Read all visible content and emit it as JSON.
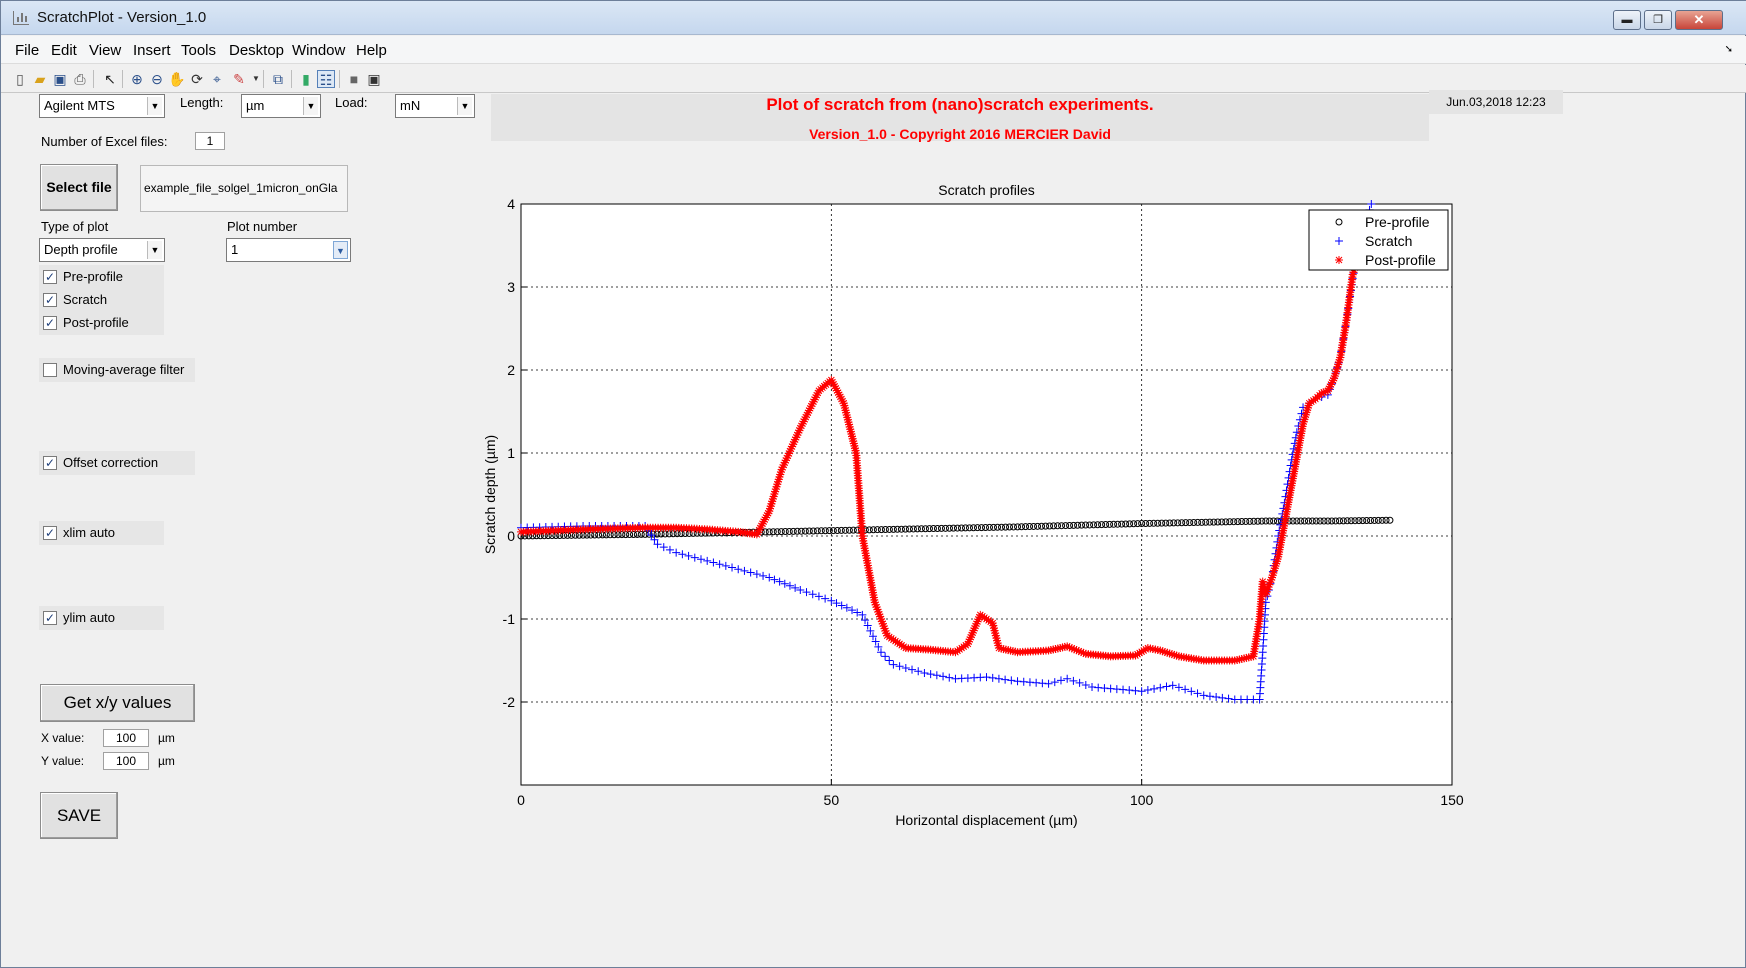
{
  "window": {
    "title": "ScratchPlot - Version_1.0",
    "minimize": "▬",
    "maximize": "❐",
    "close": "✕"
  },
  "menu": [
    "File",
    "Edit",
    "View",
    "Insert",
    "Tools",
    "Desktop",
    "Window",
    "Help"
  ],
  "toolbar_icons": [
    "new-file-icon",
    "open-folder-icon",
    "save-icon",
    "print-icon",
    "pointer-icon",
    "zoom-in-icon",
    "zoom-out-icon",
    "pan-hand-icon",
    "rotate-3d-icon",
    "data-cursor-icon",
    "brush-icon",
    "link-plot-icon",
    "colorbar-icon",
    "legend-icon",
    "hide-plot-tools-icon",
    "show-plot-tools-icon"
  ],
  "controls": {
    "instrument": "Agilent MTS",
    "length_label": "Length:",
    "length_unit": "µm",
    "load_label": "Load:",
    "load_unit": "mN",
    "num_excel_label": "Number of Excel files:",
    "num_excel_value": "1",
    "select_file": "Select file",
    "file_name": "example_file_solgel_1micron_onGla",
    "type_of_plot_label": "Type of plot",
    "type_of_plot": "Depth profile",
    "plot_number_label": "Plot number",
    "plot_number": "1",
    "checkboxes": {
      "pre_profile": {
        "label": "Pre-profile",
        "checked": true
      },
      "scratch": {
        "label": "Scratch",
        "checked": true
      },
      "post_profile": {
        "label": "Post-profile",
        "checked": true
      },
      "moving_average": {
        "label": "Moving-average filter",
        "checked": false
      },
      "offset": {
        "label": "Offset correction",
        "checked": true
      },
      "xlim_auto": {
        "label": "xlim auto",
        "checked": true
      },
      "ylim_auto": {
        "label": "ylim auto",
        "checked": true
      }
    },
    "check_mark": "✓",
    "get_xy": "Get x/y values",
    "x_value_label": "X value:",
    "x_value": "100",
    "x_unit": "µm",
    "y_value_label": "Y value:",
    "y_value": "100",
    "y_unit": "µm",
    "save": "SAVE"
  },
  "header": {
    "title": "Plot of scratch from (nano)scratch experiments.",
    "subtitle": "Version_1.0 - Copyright 2016 MERCIER David",
    "date": "Jun.03,2018 12:23"
  },
  "chart_data": {
    "type": "scatter",
    "title": "Scratch profiles",
    "xlabel": "Horizontal displacement (µm)",
    "ylabel": "Scratch depth (µm)",
    "xlim": [
      0,
      150
    ],
    "ylim": [
      -3,
      4
    ],
    "xticks": [
      "0",
      "50",
      "100",
      "150"
    ],
    "yticks": [
      "4",
      "3",
      "2",
      "1",
      "0",
      "-1",
      "-2"
    ],
    "grid": true,
    "legend_position": "top-right",
    "series": [
      {
        "name": "Pre-profile",
        "marker": "o",
        "color": "#000000",
        "points": [
          [
            0,
            0
          ],
          [
            10,
            0.01
          ],
          [
            20,
            0.02
          ],
          [
            40,
            0.05
          ],
          [
            60,
            0.08
          ],
          [
            80,
            0.11
          ],
          [
            100,
            0.15
          ],
          [
            120,
            0.18
          ],
          [
            130,
            0.18
          ],
          [
            140,
            0.19
          ]
        ]
      },
      {
        "name": "Scratch",
        "marker": "+",
        "color": "#0000ff",
        "points": [
          [
            0,
            0.1
          ],
          [
            10,
            0.12
          ],
          [
            20,
            0.12
          ],
          [
            22,
            -0.1
          ],
          [
            25,
            -0.2
          ],
          [
            30,
            -0.3
          ],
          [
            35,
            -0.4
          ],
          [
            40,
            -0.5
          ],
          [
            45,
            -0.65
          ],
          [
            50,
            -0.78
          ],
          [
            55,
            -0.95
          ],
          [
            58,
            -1.4
          ],
          [
            60,
            -1.55
          ],
          [
            65,
            -1.65
          ],
          [
            70,
            -1.72
          ],
          [
            75,
            -1.7
          ],
          [
            80,
            -1.75
          ],
          [
            85,
            -1.78
          ],
          [
            88,
            -1.72
          ],
          [
            92,
            -1.82
          ],
          [
            100,
            -1.87
          ],
          [
            105,
            -1.8
          ],
          [
            110,
            -1.92
          ],
          [
            115,
            -1.97
          ],
          [
            119,
            -1.97
          ],
          [
            119.5,
            -1.4
          ],
          [
            120,
            -0.8
          ],
          [
            121,
            -0.5
          ],
          [
            122,
            0
          ],
          [
            123,
            0.4
          ],
          [
            124,
            0.85
          ],
          [
            125,
            1.25
          ],
          [
            126,
            1.55
          ],
          [
            128,
            1.65
          ],
          [
            130,
            1.7
          ],
          [
            131,
            1.9
          ],
          [
            132,
            2.15
          ],
          [
            133,
            2.6
          ],
          [
            134,
            3.1
          ],
          [
            135,
            3.5
          ],
          [
            137,
            4.0
          ]
        ]
      },
      {
        "name": "Post-profile",
        "marker": "*",
        "color": "#ff0000",
        "points": [
          [
            0,
            0.05
          ],
          [
            10,
            0.08
          ],
          [
            20,
            0.1
          ],
          [
            25,
            0.1
          ],
          [
            30,
            0.08
          ],
          [
            35,
            0.05
          ],
          [
            38,
            0.02
          ],
          [
            40,
            0.3
          ],
          [
            42,
            0.8
          ],
          [
            45,
            1.3
          ],
          [
            48,
            1.75
          ],
          [
            50,
            1.88
          ],
          [
            52,
            1.6
          ],
          [
            54,
            1.0
          ],
          [
            55,
            0.0
          ],
          [
            57,
            -0.8
          ],
          [
            59,
            -1.2
          ],
          [
            62,
            -1.35
          ],
          [
            66,
            -1.37
          ],
          [
            70,
            -1.4
          ],
          [
            72,
            -1.3
          ],
          [
            74,
            -0.95
          ],
          [
            76,
            -1.05
          ],
          [
            77,
            -1.35
          ],
          [
            80,
            -1.4
          ],
          [
            85,
            -1.38
          ],
          [
            88,
            -1.33
          ],
          [
            91,
            -1.42
          ],
          [
            95,
            -1.45
          ],
          [
            99,
            -1.44
          ],
          [
            101,
            -1.35
          ],
          [
            103,
            -1.38
          ],
          [
            106,
            -1.45
          ],
          [
            110,
            -1.5
          ],
          [
            115,
            -1.5
          ],
          [
            118,
            -1.45
          ],
          [
            119,
            -1.0
          ],
          [
            119.5,
            -0.55
          ],
          [
            120,
            -0.7
          ],
          [
            121,
            -0.5
          ],
          [
            122,
            -0.25
          ],
          [
            123,
            0.15
          ],
          [
            124,
            0.55
          ],
          [
            125,
            0.95
          ],
          [
            126,
            1.35
          ],
          [
            127,
            1.6
          ],
          [
            128,
            1.65
          ],
          [
            129,
            1.72
          ],
          [
            130,
            1.75
          ],
          [
            131,
            1.9
          ],
          [
            132,
            2.15
          ],
          [
            133,
            2.6
          ],
          [
            134,
            3.15
          ],
          [
            135,
            3.4
          ]
        ]
      }
    ]
  }
}
